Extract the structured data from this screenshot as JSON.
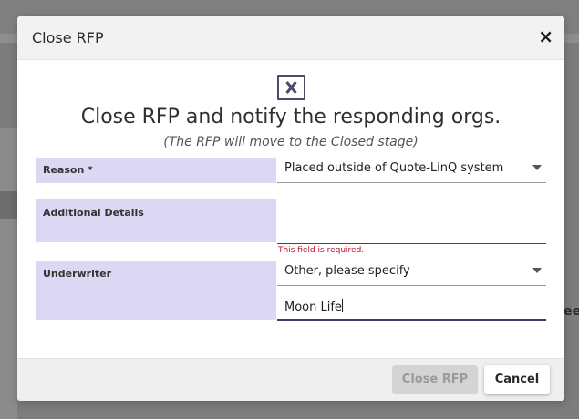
{
  "background": {
    "edge_text": "ees"
  },
  "modal": {
    "title": "Close RFP",
    "close_symbol": "×",
    "heading": "Close RFP and notify the responding orgs.",
    "subheading": "(The RFP will move to the Closed stage)",
    "fields": {
      "reason": {
        "label": "Reason *",
        "value": "Placed outside of Quote-LinQ system"
      },
      "additional_details": {
        "label": "Additional Details",
        "value": "",
        "error": "This field is required."
      },
      "underwriter": {
        "label": "Underwriter",
        "select_value": "Other, please specify",
        "input_value": "Moon Life"
      }
    },
    "buttons": {
      "close_rfp": "Close RFP",
      "cancel": "Cancel"
    }
  },
  "colors": {
    "label_bg": "#dcd7f2",
    "error": "#c0102a",
    "focus_underline": "#3c3a6a",
    "disabled_button": "#d4d4d4"
  },
  "icons": [
    "close-icon",
    "x-box-icon",
    "dropdown-arrow-icon"
  ]
}
